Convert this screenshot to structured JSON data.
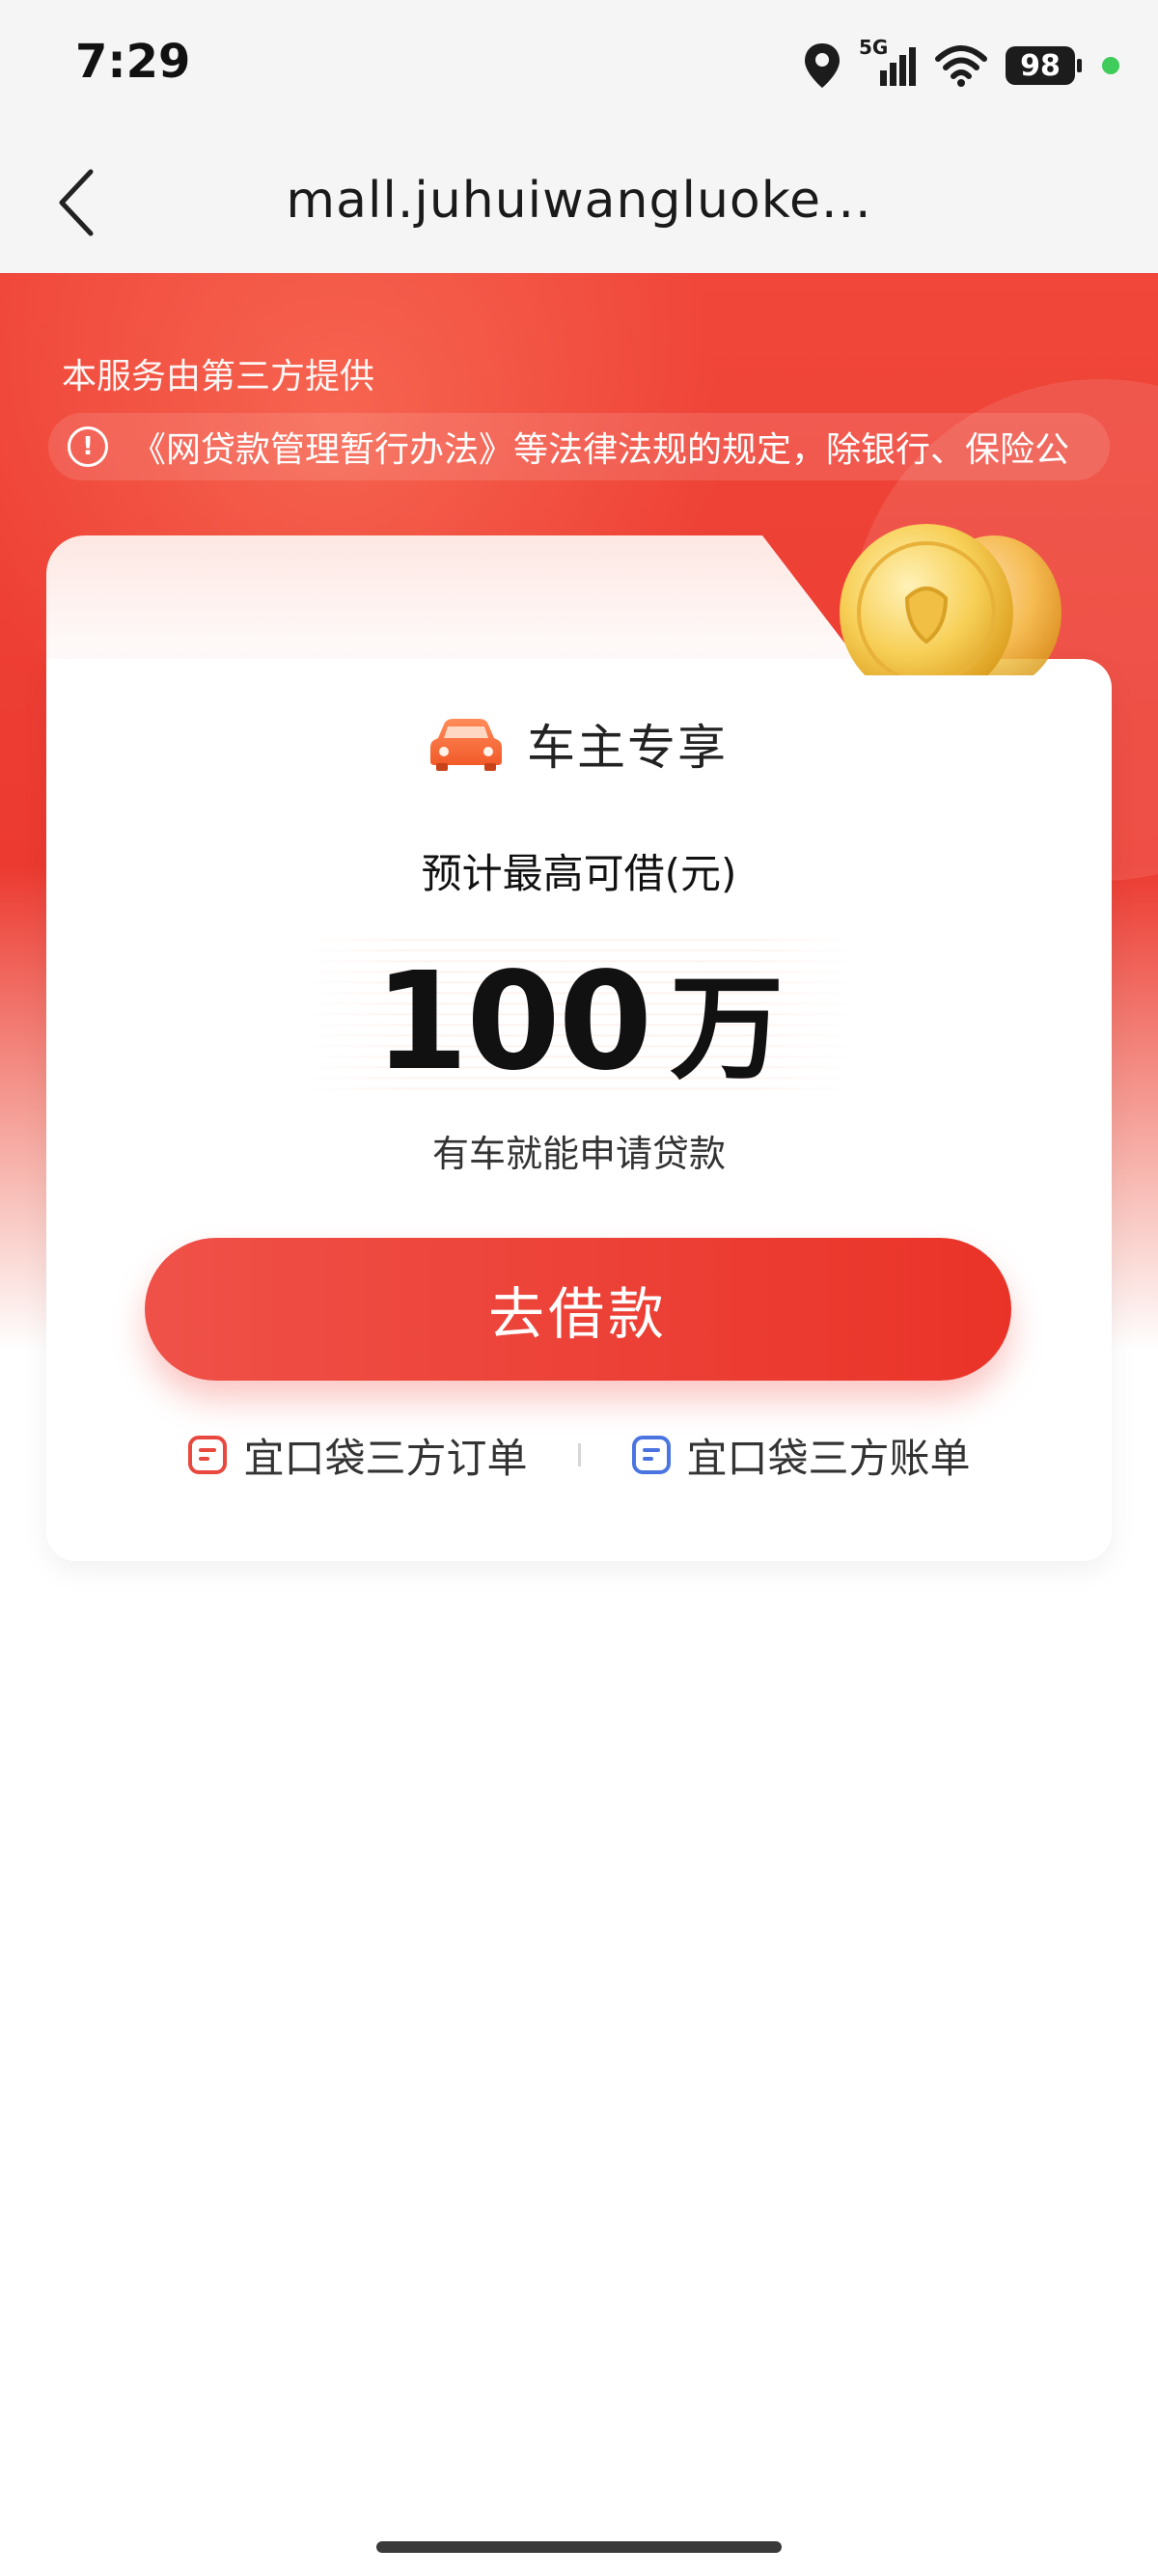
{
  "status_bar": {
    "time": "7:29",
    "network_label": "5G",
    "battery": "98",
    "icons": [
      "location-icon",
      "signal-icon",
      "wifi-icon",
      "battery-icon"
    ]
  },
  "nav": {
    "title": "mall.juhuiwangluoke...",
    "back_icon": "chevron-left-icon"
  },
  "hero": {
    "provider_text": "本服务由第三方提供",
    "notice_text": "《网贷款管理暂行办法》等法律法规的规定，除银行、保险公"
  },
  "card": {
    "vip_label": "车主专享",
    "estimate_label": "预计最高可借(元)",
    "amount_value": "100",
    "amount_unit": "万",
    "subtitle": "有车就能申请贷款",
    "borrow_button": "去借款",
    "links": {
      "orders": "宜口袋三方订单",
      "bills": "宜口袋三方账单"
    }
  },
  "colors": {
    "brand_red": "#ec3a30",
    "link_order_icon": "#e8483e",
    "link_bill_icon": "#4a74e0"
  }
}
